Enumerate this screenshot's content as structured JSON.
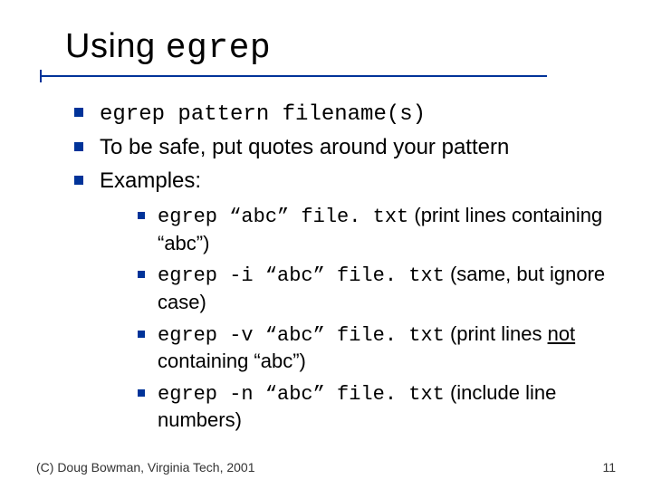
{
  "title": {
    "prefix": "Using ",
    "cmd": "egrep"
  },
  "bullets": {
    "b1_cmd": "egrep pattern filename(s)",
    "b2": "To be safe, put quotes around your pattern",
    "b3": "Examples:"
  },
  "examples": {
    "e1_cmd": "egrep “abc” file. txt",
    "e1_desc_a": " (print lines containing “abc”)",
    "e2_cmd": "egrep -i “abc” file. txt",
    "e2_desc_a": " (same, but ignore case)",
    "e3_cmd": "egrep -v “abc” file. txt",
    "e3_desc_a": " (print lines ",
    "e3_desc_u": "not",
    "e3_desc_b": " containing “abc”)",
    "e4_cmd": "egrep -n “abc” file. txt",
    "e4_desc_a": " (include line numbers)"
  },
  "footer": {
    "left": "(C) Doug Bowman, Virginia Tech, 2001",
    "right": "11"
  }
}
